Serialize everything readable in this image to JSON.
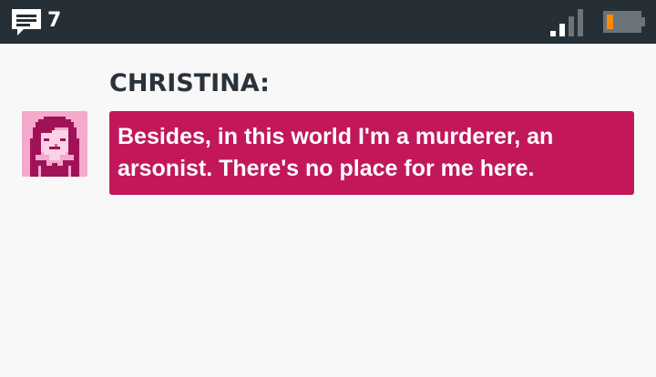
{
  "status_bar": {
    "message_count": "7",
    "icons": {
      "messages": "chat-bubble-icon",
      "signal": "signal-strength-icon",
      "battery": "battery-low-icon"
    },
    "colors": {
      "background": "#262e36",
      "battery_level": "#ff8c00",
      "signal_active": "#ffffff",
      "signal_inactive": "#6b737b"
    },
    "battery_level": 0.2,
    "signal_bars_active": 2,
    "signal_bars_total": 4
  },
  "dialog": {
    "speaker": "CHRISTINA:",
    "line": "Besides, in this world I'm a murderer, an arsonist. There's no place for me here.",
    "colors": {
      "bubble": "#c2185b",
      "text": "#ffffff",
      "speaker": "#2a323a",
      "avatar_bg": "#f5a9cc",
      "avatar_ink": "#a01257"
    }
  }
}
